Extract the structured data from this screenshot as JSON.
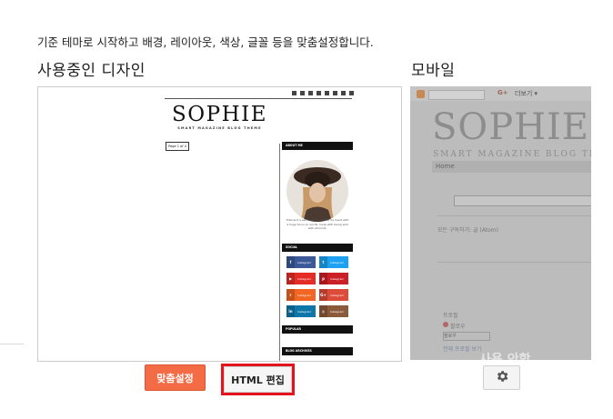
{
  "intro": "기준 테마로 시작하고 배경, 레이아웃, 색상, 글꼴 등을 맞춤설정합니다.",
  "sections": {
    "current_design": "사용중인 디자인",
    "mobile": "모바일"
  },
  "desktop_preview": {
    "logo": "SOPHIE",
    "tagline": "SMART MAGAZINE BLOG THEME",
    "page_button": "Page 1 of 4",
    "widgets": {
      "about": "ABOUT ME",
      "social": "SOCIAL",
      "popular": "POPULAR",
      "archive": "BLOG ARCHIVES"
    },
    "about_text": "Total and a self-described writer by heart with a huge focus on words, loves with being wild with all kinds.",
    "social_items": [
      {
        "icon": "facebook-icon",
        "glyph": "f",
        "label": "Instagram",
        "color": "#3b5998"
      },
      {
        "icon": "twitter-icon",
        "glyph": "t",
        "label": "Instagram",
        "color": "#1da1f2"
      },
      {
        "icon": "youtube-icon",
        "glyph": "▶",
        "label": "Instagram",
        "color": "#e52d27"
      },
      {
        "icon": "pinterest-icon",
        "glyph": "p",
        "label": "Instagram",
        "color": "#cb2027"
      },
      {
        "icon": "rss-icon",
        "glyph": "r",
        "label": "Instagram",
        "color": "#f26522"
      },
      {
        "icon": "googleplus-icon",
        "glyph": "G+",
        "label": "Instagram",
        "color": "#dd4b39"
      },
      {
        "icon": "linkedin-icon",
        "glyph": "in",
        "label": "Instagram",
        "color": "#0e76a8"
      },
      {
        "icon": "instagram-icon",
        "glyph": "◎",
        "label": "Instagram",
        "color": "#8a5a3b"
      }
    ]
  },
  "mobile_preview": {
    "logo": "SOPHIE",
    "tagline": "SMART MAGAZINE BLOG THEME",
    "more_label": "더보기 ▾",
    "home_label": "Home",
    "post_line": "모든 구독하기: 글 (Atom)",
    "profile_heading": "프로필",
    "receive_label": "팔로우",
    "select_label": "팔로우",
    "link_label": "전체 프로필 보기",
    "overlay_text": "사용 안함"
  },
  "buttons": {
    "customize": "맞춤설정",
    "edit_html": "HTML 편집",
    "mobile_settings_icon": "gear-icon"
  },
  "colors": {
    "accent": "#f46c46",
    "highlight": "#e4141e"
  }
}
